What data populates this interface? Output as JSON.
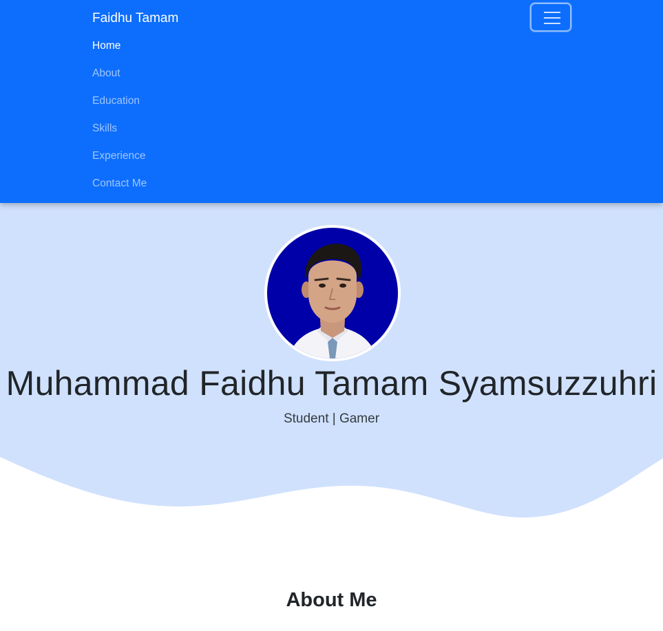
{
  "navbar": {
    "brand": "Faidhu Tamam",
    "toggle_icon": "hamburger-menu-icon",
    "items": [
      {
        "label": "Home",
        "active": true
      },
      {
        "label": "About",
        "active": false
      },
      {
        "label": "Education",
        "active": false
      },
      {
        "label": "Skills",
        "active": false
      },
      {
        "label": "Experience",
        "active": false
      },
      {
        "label": "Contact Me",
        "active": false
      }
    ]
  },
  "hero": {
    "name": "Muhammad Faidhu Tamam Syamsuzzuhri",
    "subtitle": "Student | Gamer"
  },
  "about": {
    "title": "About Me"
  },
  "colors": {
    "navbar_bg": "#0d6efd",
    "hero_bg": "#d0e1fd",
    "photo_bg": "#0000a8"
  }
}
